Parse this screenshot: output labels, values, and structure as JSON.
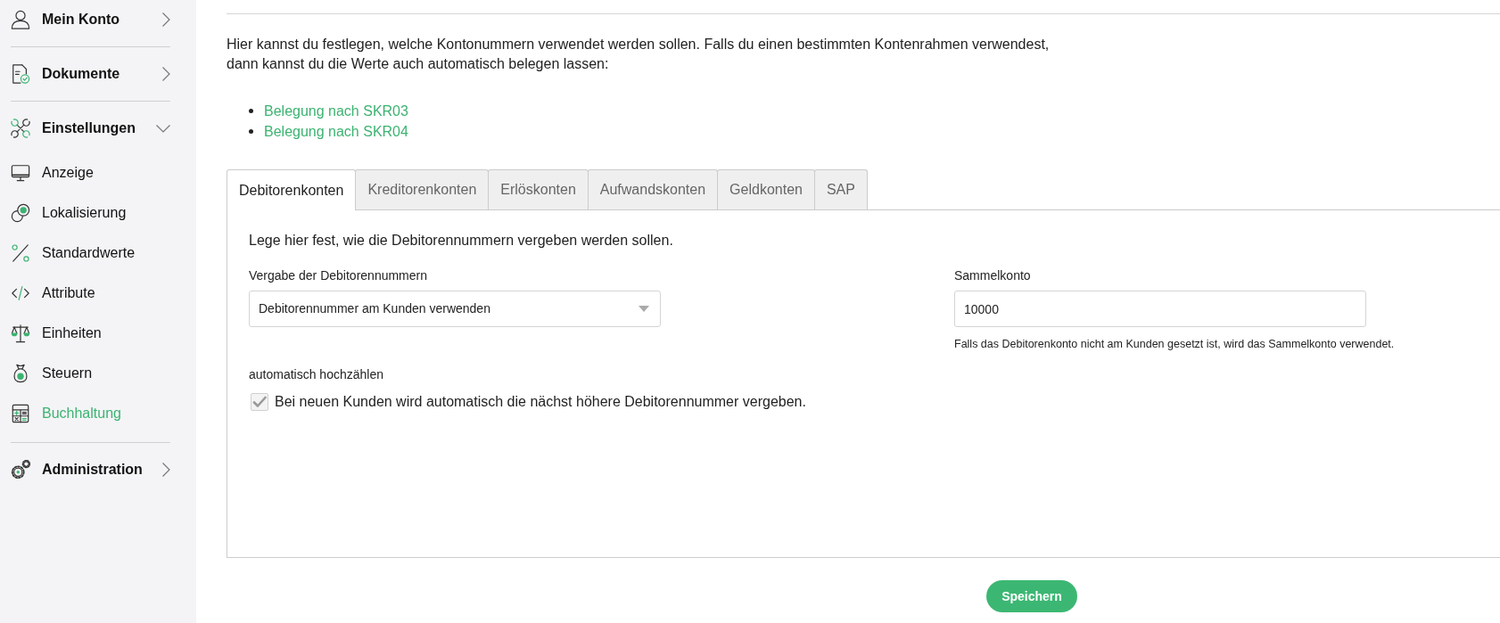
{
  "sidebar": {
    "sections": [
      {
        "label": "Mein Konto",
        "expanded": false
      },
      {
        "label": "Dokumente",
        "expanded": false
      },
      {
        "label": "Einstellungen",
        "expanded": true,
        "children": [
          {
            "label": "Anzeige",
            "selected": false
          },
          {
            "label": "Lokalisierung",
            "selected": false
          },
          {
            "label": "Standardwerte",
            "selected": false
          },
          {
            "label": "Attribute",
            "selected": false
          },
          {
            "label": "Einheiten",
            "selected": false
          },
          {
            "label": "Steuern",
            "selected": false
          },
          {
            "label": "Buchhaltung",
            "selected": true
          }
        ]
      },
      {
        "label": "Administration",
        "expanded": false
      }
    ]
  },
  "intro": "Hier kannst du festlegen, welche Kontonummern verwendet werden sollen. Falls du einen bestimmten Kontenrahmen verwendest,\ndann kannst du die Werte auch automatisch belegen lassen:",
  "links": [
    "Belegung nach SKR03",
    "Belegung nach SKR04"
  ],
  "tabs": [
    {
      "label": "Debitorenkonten",
      "selected": true
    },
    {
      "label": "Kreditorenkonten",
      "selected": false
    },
    {
      "label": "Erlöskonten",
      "selected": false
    },
    {
      "label": "Aufwandskonten",
      "selected": false
    },
    {
      "label": "Geldkonten",
      "selected": false
    },
    {
      "label": "SAP",
      "selected": false
    }
  ],
  "panel": {
    "description": "Lege hier fest, wie die Debitorennummern vergeben werden sollen.",
    "fields": [
      {
        "kind": "select",
        "label": "Vergabe der Debitorennummern",
        "value": "Debitorennummer am Kunden verwenden"
      },
      {
        "kind": "text",
        "label": "Sammelkonto",
        "value": "10000",
        "hint": "Falls das Debitorenkonto nicht am Kunden gesetzt ist, wird das Sammelkonto verwendet."
      }
    ],
    "auto_increment": {
      "label": "automatisch hochzählen",
      "checkbox": {
        "label": "Bei neuen Kunden wird automatisch die nächst höhere Debitorennummer vergeben.",
        "checked": true
      }
    }
  },
  "save_button": "Speichern"
}
